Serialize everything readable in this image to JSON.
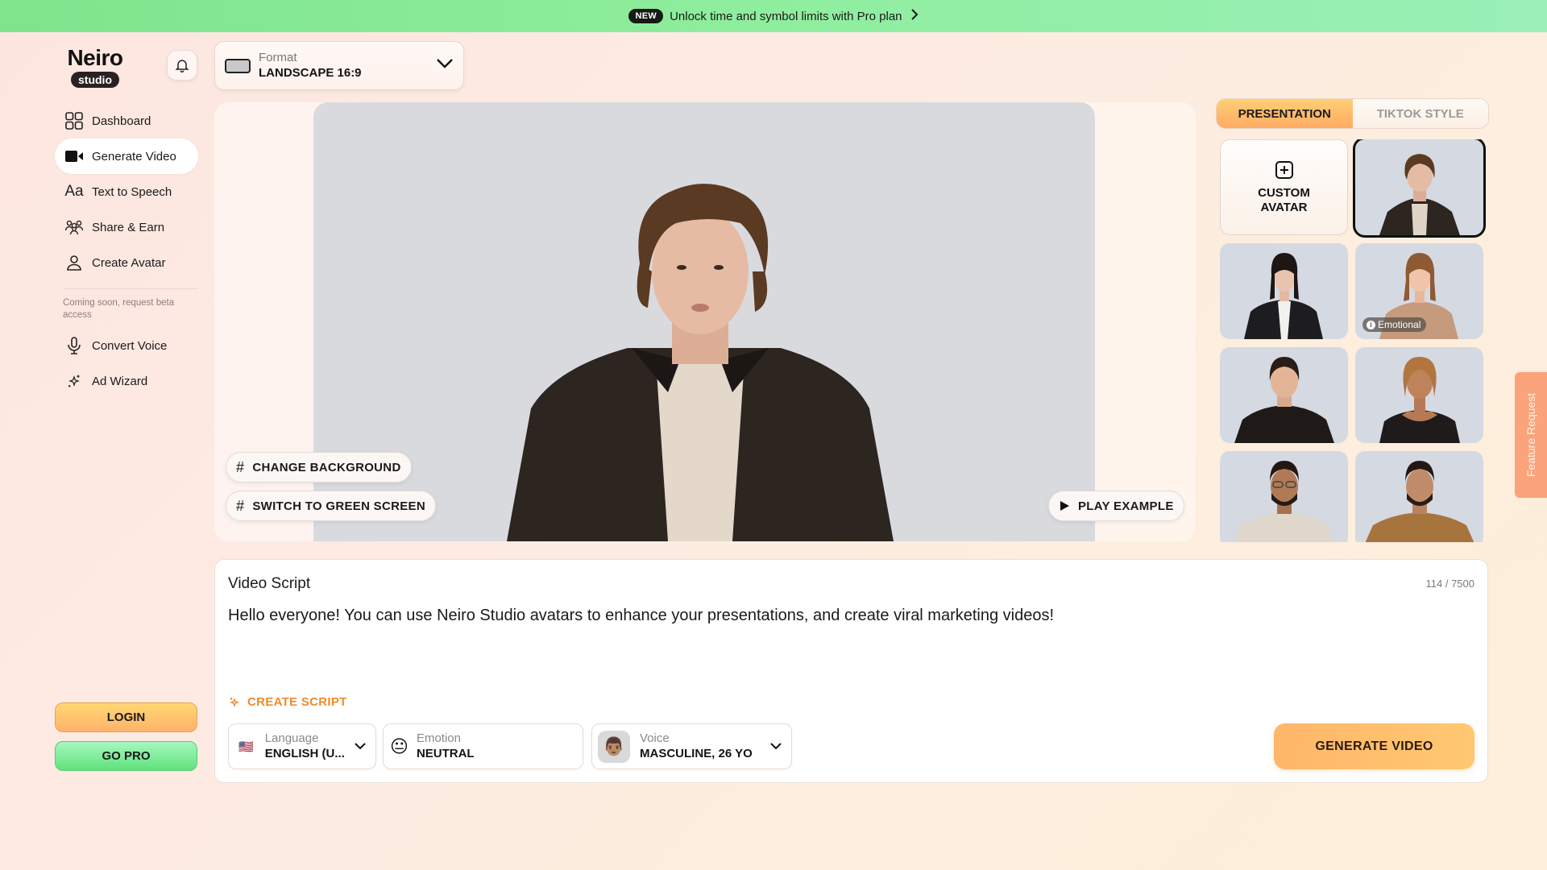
{
  "promo": {
    "badge": "NEW",
    "text": "Unlock time and symbol limits with Pro plan",
    "chevron": "›"
  },
  "logo": {
    "brand": "Neiro",
    "sub": "studio"
  },
  "sidebar": {
    "items": [
      {
        "label": "Dashboard",
        "icon": "grid-icon",
        "active": false
      },
      {
        "label": "Generate Video",
        "icon": "video-camera-icon",
        "active": true
      },
      {
        "label": "Text to Speech",
        "icon": "text-aa-icon",
        "active": false
      },
      {
        "label": "Share & Earn",
        "icon": "users-group-icon",
        "active": false
      },
      {
        "label": "Create Avatar",
        "icon": "user-icon",
        "active": false
      }
    ],
    "coming_soon_note": "Coming soon, request beta access",
    "beta_items": [
      {
        "label": "Convert Voice",
        "icon": "microphone-icon"
      },
      {
        "label": "Ad Wizard",
        "icon": "sparkles-icon"
      }
    ],
    "login_label": "LOGIN",
    "go_pro_label": "GO PRO"
  },
  "format": {
    "label": "Format",
    "value": "LANDSCAPE 16:9"
  },
  "preview": {
    "change_background_label": "CHANGE BACKGROUND",
    "green_screen_label": "SWITCH TO GREEN SCREEN",
    "play_example_label": "PLAY EXAMPLE"
  },
  "avatar_panel": {
    "tabs": [
      {
        "label": "PRESENTATION",
        "active": true
      },
      {
        "label": "TIKTOK STYLE",
        "active": false
      }
    ],
    "custom_avatar_label": "CUSTOM AVATAR",
    "avatars": [
      {
        "name": "avatar-young-man-jacket",
        "selected": true,
        "tag": null
      },
      {
        "name": "avatar-woman-black-suit",
        "selected": false,
        "tag": null
      },
      {
        "name": "avatar-woman-tan-blazer",
        "selected": false,
        "tag": "Emotional"
      },
      {
        "name": "avatar-man-black-polo",
        "selected": false,
        "tag": null
      },
      {
        "name": "avatar-woman-black-top",
        "selected": false,
        "tag": null
      },
      {
        "name": "avatar-man-glasses-beige",
        "selected": false,
        "tag": null
      },
      {
        "name": "avatar-man-brown-sweater",
        "selected": false,
        "tag": null
      }
    ]
  },
  "feature_request_label": "Feature Request",
  "script": {
    "title": "Video Script",
    "char_count": "114 / 7500",
    "text": "Hello everyone! You can use Neiro Studio avatars to enhance your presentations, and create viral marketing videos!",
    "create_script_label": "CREATE SCRIPT",
    "language": {
      "label": "Language",
      "value": "ENGLISH (U...",
      "flag": "🇺🇸"
    },
    "emotion": {
      "label": "Emotion",
      "value": "NEUTRAL",
      "emoji": "😐"
    },
    "voice": {
      "label": "Voice",
      "value": "MASCULINE, 26 YO",
      "emoji": "👨🏽"
    },
    "generate_label": "GENERATE VIDEO"
  },
  "colors": {
    "accent_orange": "#ffb66a",
    "create_script_orange": "#ef8b2e",
    "promo_green": "#8fee9e",
    "feature_request": "#fba37a"
  }
}
